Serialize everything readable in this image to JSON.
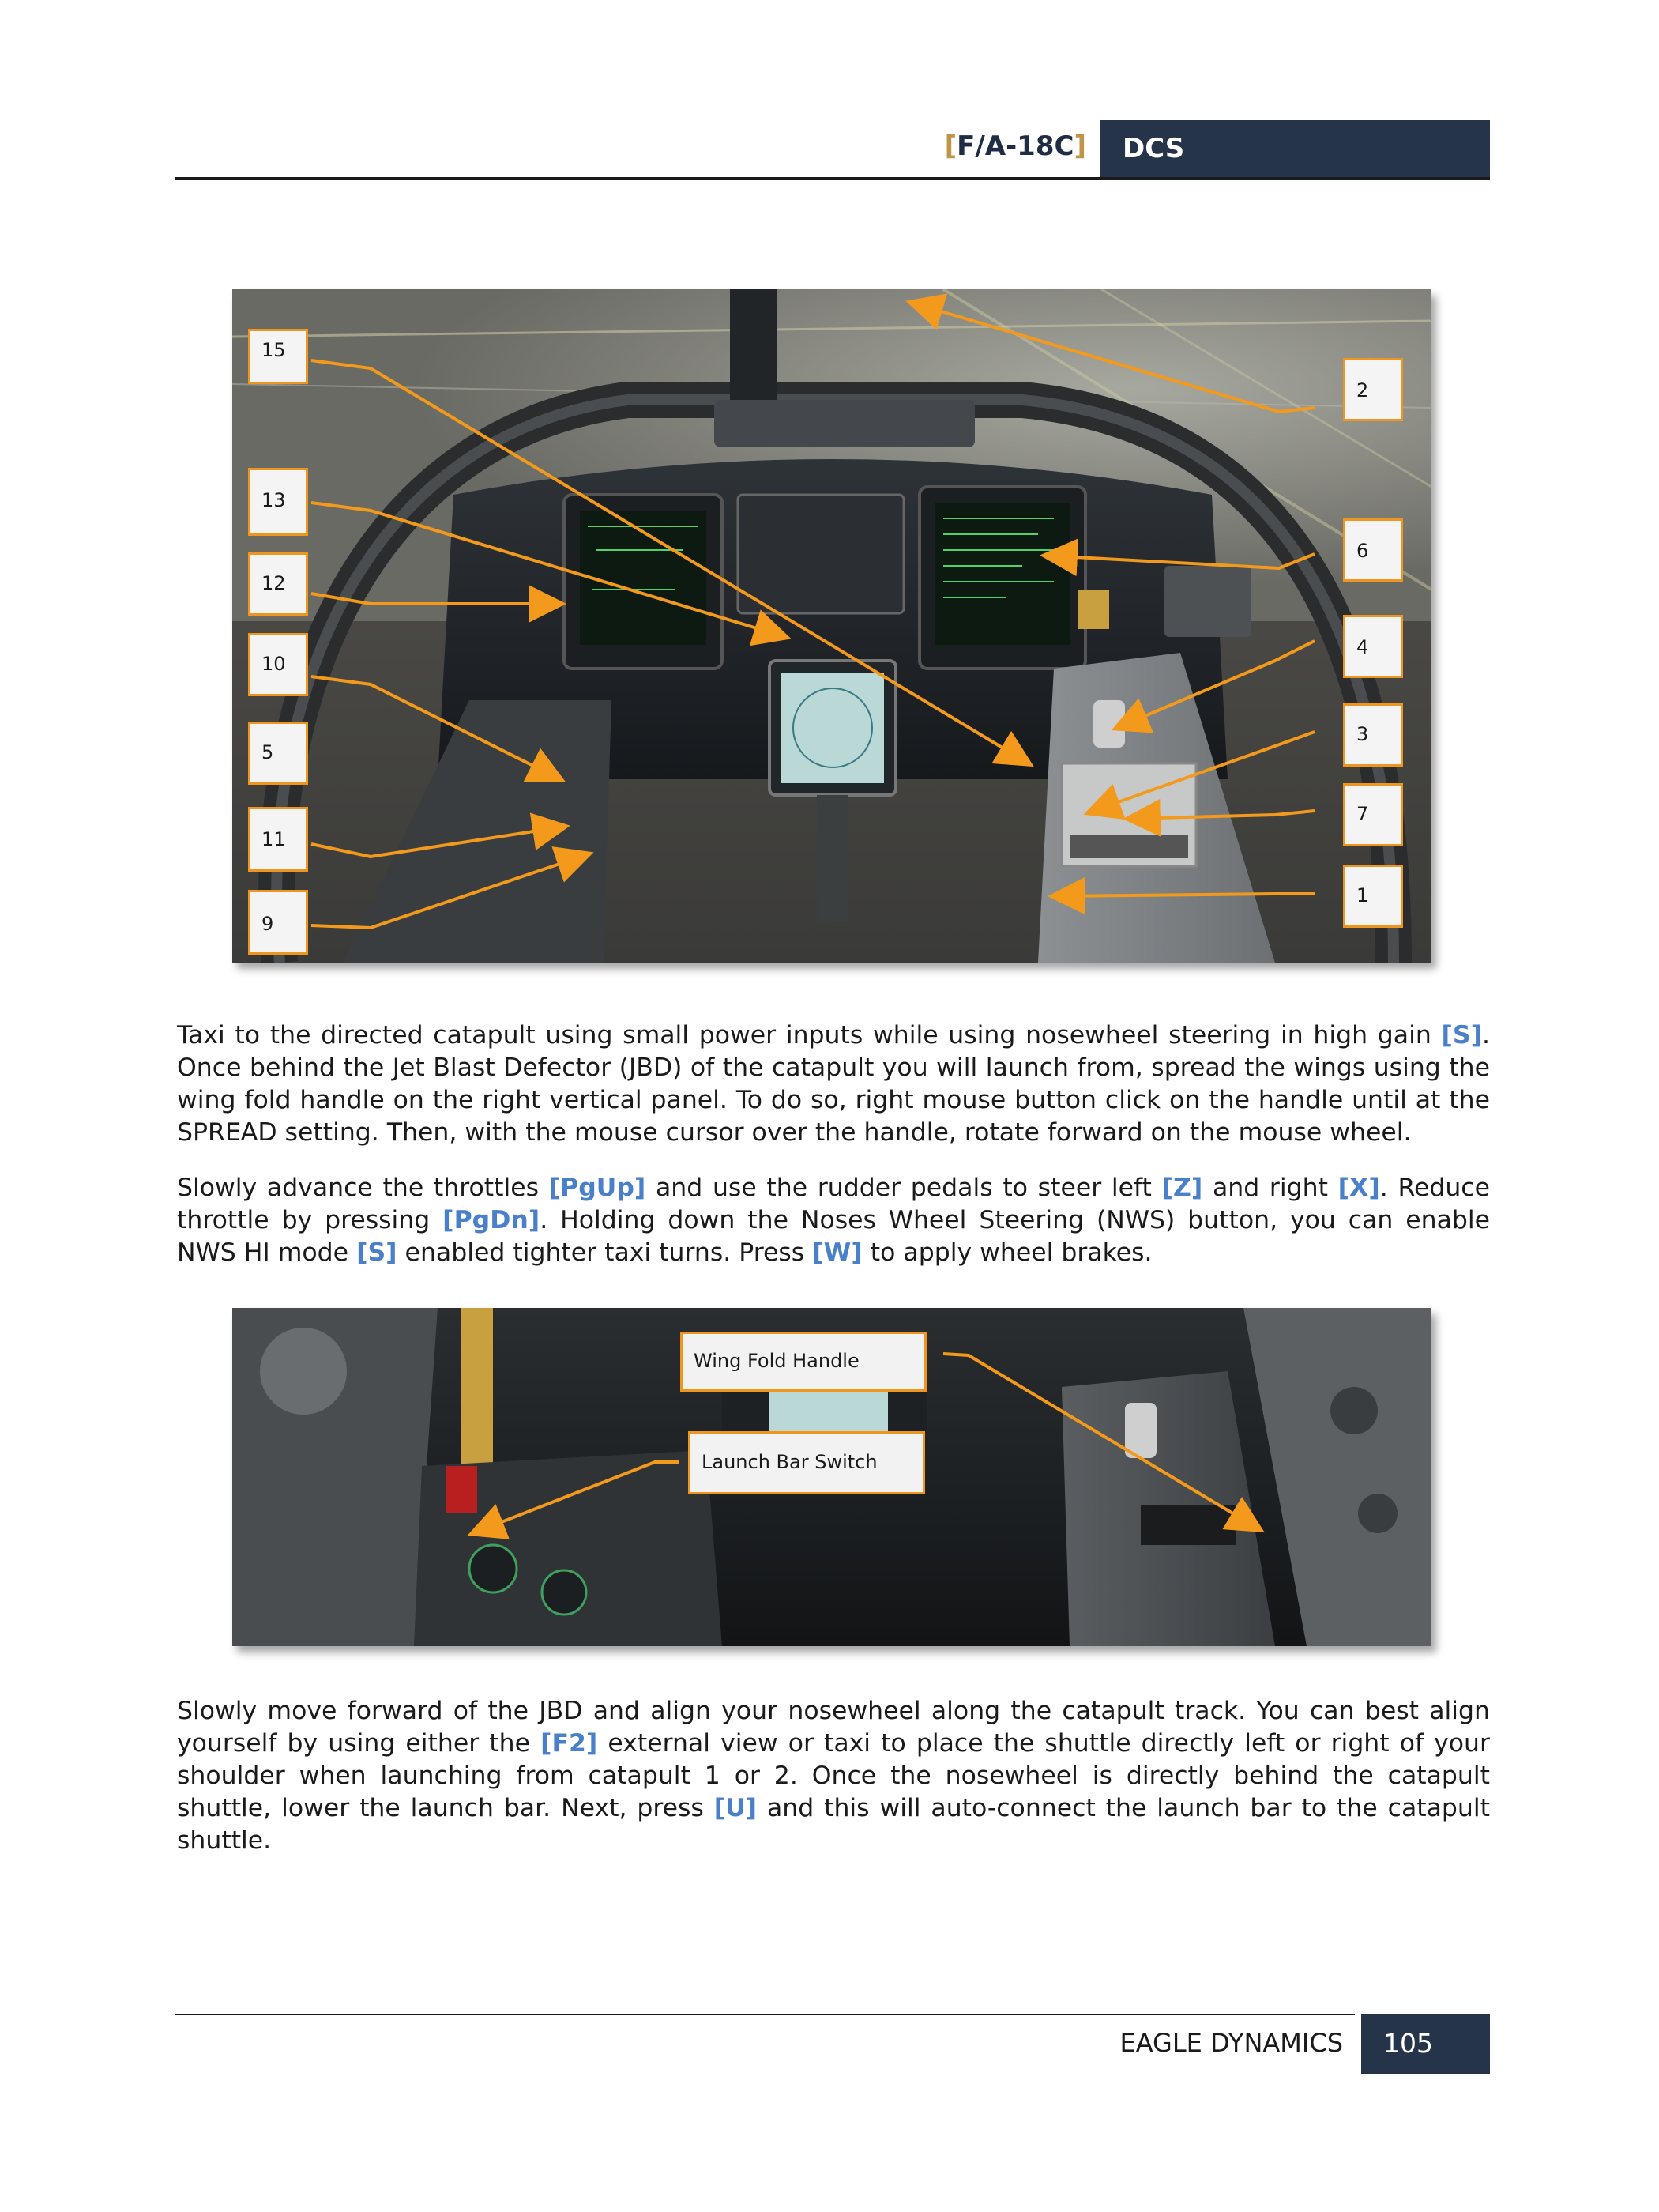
{
  "header": {
    "title_open": "[",
    "title_main": "F/A-18C",
    "title_close": "]",
    "brand": "DCS"
  },
  "figure1": {
    "callouts": [
      "15",
      "2",
      "13",
      "6",
      "12",
      "4",
      "10",
      "3",
      "5",
      "7",
      "11",
      "1",
      "9"
    ]
  },
  "paragraph1": {
    "t1": "Taxi to the directed catapult using small power inputs while using nosewheel steering in high gain ",
    "k1": "[S]",
    "t2": ". Once behind the Jet Blast Defector (JBD) of the catapult you will launch from, spread the wings using the wing fold handle on the right vertical panel. To do so, right mouse button click on the handle until at the SPREAD setting. Then, with the mouse cursor over the handle, rotate forward on the mouse wheel."
  },
  "paragraph2": {
    "t1": "Slowly advance the throttles ",
    "k1": "[PgUp]",
    "t2": " and use the rudder pedals to steer left ",
    "k2": "[Z]",
    "t3": " and right ",
    "k3": "[X]",
    "t4": ". Reduce throttle by pressing ",
    "k4": "[PgDn]",
    "t5": ". Holding down the Noses Wheel Steering (NWS) button, you can enable NWS HI mode ",
    "k5": "[S]",
    "t6": " enabled tighter taxi turns. Press ",
    "k6": "[W]",
    "t7": " to apply wheel brakes."
  },
  "figure2": {
    "label_wing_fold": "Wing Fold Handle",
    "label_launch_bar": "Launch Bar Switch"
  },
  "paragraph3": {
    "t1": "Slowly move forward of the JBD and align your nosewheel along the catapult track. You can best align yourself by using either the ",
    "k1": "[F2]",
    "t2": " external view or taxi to place the shuttle directly left or right of your shoulder when launching from catapult 1 or 2. Once the nosewheel is directly behind the catapult shuttle, lower the launch bar. Next, press ",
    "k2": "[U]",
    "t3": " and this will auto-connect the launch bar to the catapult shuttle."
  },
  "footer": {
    "company": "EAGLE DYNAMICS",
    "page_number": "105"
  },
  "colors": {
    "header_box": "#253448",
    "keybind": "#4a7fc9",
    "callout_border": "#f0961e",
    "callout_arrow": "#f39a1c"
  }
}
